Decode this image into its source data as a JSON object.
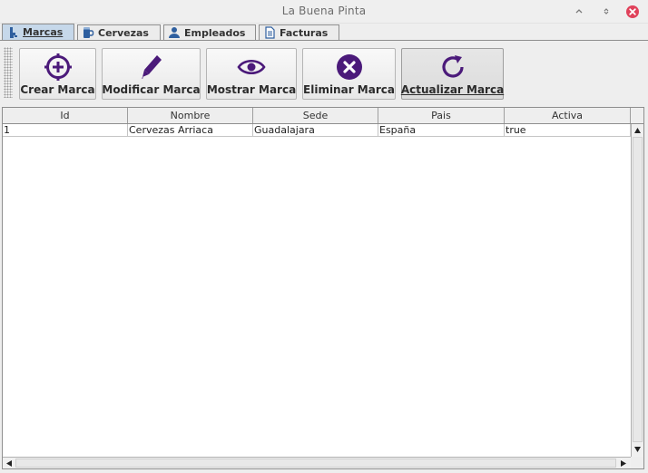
{
  "window": {
    "title": "La Buena Pinta"
  },
  "tabs": [
    {
      "label": "Marcas",
      "icon": "beer-tap-icon",
      "active": true
    },
    {
      "label": "Cervezas",
      "icon": "beer-mug-icon",
      "active": false
    },
    {
      "label": "Empleados",
      "icon": "user-icon",
      "active": false
    },
    {
      "label": "Facturas",
      "icon": "document-icon",
      "active": false
    }
  ],
  "toolbar": {
    "buttons": [
      {
        "label": "Crear Marca",
        "icon": "add-circle-icon"
      },
      {
        "label": "Modificar Marca",
        "icon": "pencil-icon"
      },
      {
        "label": "Mostrar Marca",
        "icon": "eye-icon"
      },
      {
        "label": "Eliminar Marca",
        "icon": "delete-circle-icon"
      },
      {
        "label": "Actualizar Marca",
        "icon": "refresh-icon"
      }
    ]
  },
  "table": {
    "columns": [
      "Id",
      "Nombre",
      "Sede",
      "Pais",
      "Activa"
    ],
    "rows": [
      [
        "1",
        "Cervezas Arriaca",
        "Guadalajara",
        "España",
        "true"
      ]
    ]
  },
  "colors": {
    "icon_purple": "#4b1a7a",
    "active_tab": "#c6d8ea",
    "close_button": "#e0415a",
    "tab_icon_blue": "#2f5f9f"
  }
}
